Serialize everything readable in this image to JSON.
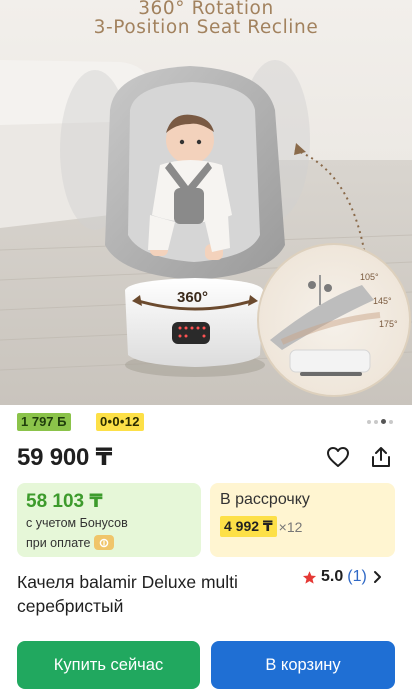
{
  "hero": {
    "title_line1": "360° Rotation",
    "title_line2": "3-Position Seat Recline",
    "rotation_label": "360°",
    "angle_105": "105°",
    "angle_145": "145°",
    "angle_175": "175°"
  },
  "gallery": {
    "dot_count": 4,
    "active_index": 2
  },
  "badges": {
    "bonus": "1 797 Б",
    "installment": "0•0•12"
  },
  "price": {
    "value": "59 900 ₸"
  },
  "offer_bonus": {
    "amount": "58 103 ₸",
    "line1": "с учетом Бонусов",
    "line2": "при оплате",
    "coin_icon": "bonus-coin-icon"
  },
  "offer_installment": {
    "label": "В рассрочку",
    "monthly": "4 992 ₸",
    "months": "×12"
  },
  "product": {
    "name": "Качеля balamir Deluxe multi серебристый"
  },
  "rating": {
    "value": "5.0",
    "count": "(1)"
  },
  "actions": {
    "buy_now": "Купить сейчас",
    "add_to_cart": "В корзину"
  },
  "colors": {
    "accent_green": "#21a85f",
    "accent_blue": "#1f6fd4",
    "bonus_green": "#8bc34a",
    "installment_yellow": "#fde047",
    "price_green": "#3d9b2c",
    "rating_star": "#e53935",
    "hero_title": "#a2825e"
  }
}
